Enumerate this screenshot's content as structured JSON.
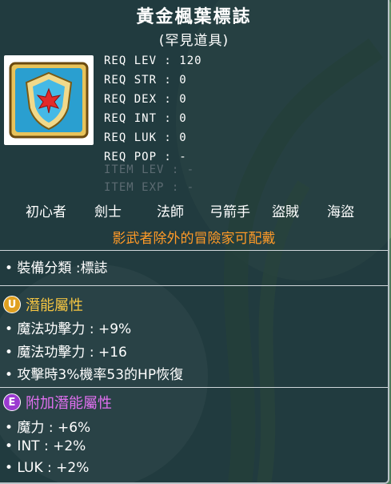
{
  "item": {
    "name": "黃金楓葉標誌",
    "rarity": "(罕見道具)"
  },
  "requirements": [
    {
      "label": "REQ LEV",
      "value": "120",
      "dim": false
    },
    {
      "label": "REQ STR",
      "value": "0",
      "dim": false
    },
    {
      "label": "REQ DEX",
      "value": "0",
      "dim": false
    },
    {
      "label": "REQ INT",
      "value": "0",
      "dim": false
    },
    {
      "label": "REQ LUK",
      "value": "0",
      "dim": false
    },
    {
      "label": "REQ POP",
      "value": "-",
      "dim": false
    },
    {
      "label": "ITEM LEV",
      "value": "-",
      "dim": true
    },
    {
      "label": "ITEM EXP",
      "value": "-",
      "dim": true
    }
  ],
  "req_lines": [
    "REQ LEV : 120",
    "REQ STR : 0",
    "REQ DEX : 0",
    "REQ INT : 0",
    "REQ LUK : 0",
    "REQ POP : -",
    "ITEM LEV : -",
    "ITEM EXP : -"
  ],
  "jobs": [
    "初心者",
    "劍士",
    "法師",
    "弓箭手",
    "盜賊",
    "海盜"
  ],
  "job_notice": "影武者除外的冒險家可配戴",
  "equip_type": "• 裝備分類 :標誌",
  "potential": {
    "badge": "U",
    "title": "潛能屬性",
    "color": "#f5c542",
    "lines": [
      "• 魔法功擊力 : +9%",
      "• 魔法功擊力 : +16",
      "• 攻擊時3%機率53的HP恢復"
    ]
  },
  "additional": {
    "badge": "E",
    "title": "附加潛能屬性",
    "color": "#e070f0",
    "lines": [
      "• 魔力 : +6%",
      "• INT : +2%",
      "• LUK : +2%"
    ]
  }
}
